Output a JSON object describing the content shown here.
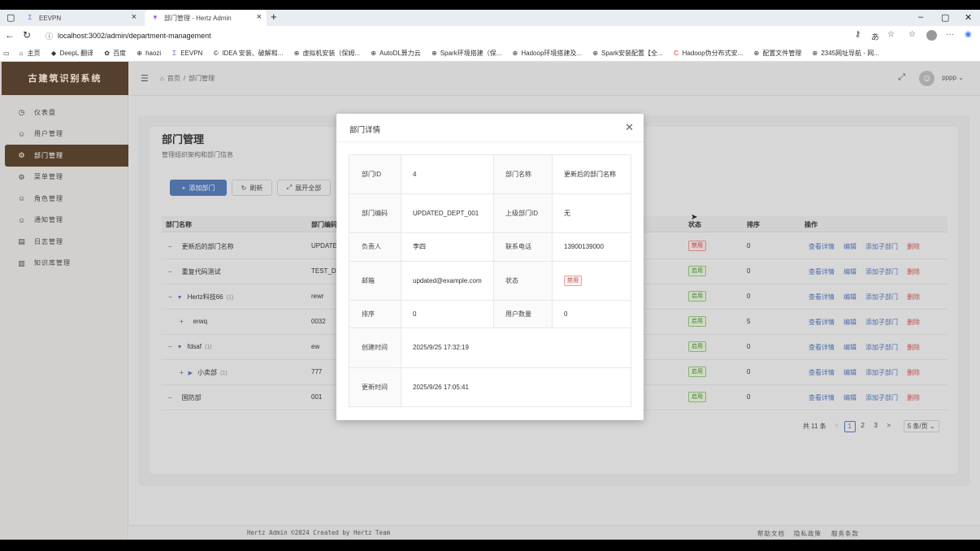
{
  "browser": {
    "tabs": [
      {
        "title": "EEVPN",
        "icon": "vpn-icon"
      },
      {
        "title": "部门管理 - Hertz Admin",
        "icon": "vite-icon"
      }
    ],
    "new_tab": "+",
    "url": "localhost:3002/admin/department-management",
    "bookmarks": [
      "主页",
      "DeepL 翻译",
      "百度",
      "haozi",
      "EEVPN",
      "IDEA 安装、破解和...",
      "虚拟机安装（保姆...",
      "AutoDL算力云",
      "Spark环境搭建（保...",
      "Hadoop环境搭建及...",
      "Spark安装配置【全...",
      "Hadoop伪分布式安...",
      "配置文件管理",
      "2345网址导航 - 网..."
    ]
  },
  "app": {
    "brand": "古建筑识别系统",
    "menu": [
      {
        "label": "仪表盘",
        "icon": "dashboard-icon"
      },
      {
        "label": "用户管理",
        "icon": "user-icon"
      },
      {
        "label": "部门管理",
        "icon": "gear-icon",
        "active": true
      },
      {
        "label": "菜单管理",
        "icon": "gear-icon"
      },
      {
        "label": "角色管理",
        "icon": "user-icon"
      },
      {
        "label": "通知管理",
        "icon": "user-icon"
      },
      {
        "label": "日志管理",
        "icon": "log-icon"
      },
      {
        "label": "知识库管理",
        "icon": "book-icon"
      }
    ],
    "breadcrumb": {
      "home": "首页",
      "sep": "/",
      "current": "部门管理"
    },
    "user": "pppp"
  },
  "page": {
    "title": "部门管理",
    "subtitle": "管理组织架构和部门信息",
    "buttons": {
      "add": "添加部门",
      "refresh": "刷新",
      "expand": "展开全部"
    },
    "columns": {
      "name": "部门名称",
      "code": "部门编码",
      "status": "状态",
      "sort": "排序",
      "ops": "操作"
    },
    "rows": [
      {
        "prefix": "−",
        "caret": "",
        "name": "更新后的部门名称",
        "count": "",
        "code": "UPDATE",
        "status": "禁用",
        "sort": "0"
      },
      {
        "prefix": "−",
        "caret": "",
        "name": "重复代码测试",
        "count": "",
        "code": "TEST_DE",
        "status": "启用",
        "sort": "0"
      },
      {
        "prefix": "−",
        "caret": "▼",
        "name": "Hertz科技66",
        "count": "(1)",
        "code": "rewr",
        "status": "启用",
        "sort": "0"
      },
      {
        "prefix": "+",
        "caret": "",
        "name": "erwq",
        "count": "",
        "code": "0032",
        "status": "启用",
        "sort": "5"
      },
      {
        "prefix": "−",
        "caret": "▼",
        "name": "fdsaf",
        "count": "(1)",
        "code": "ew",
        "status": "启用",
        "sort": "0"
      },
      {
        "prefix": "+",
        "caret": "▶",
        "name": "小卖部",
        "count": "(1)",
        "code": "777",
        "status": "启用",
        "sort": "0"
      },
      {
        "prefix": "−",
        "caret": "",
        "name": "国防部",
        "count": "",
        "code": "001",
        "status": "启用",
        "sort": "0"
      }
    ],
    "ops": {
      "view": "查看详情",
      "edit": "编辑",
      "add_child": "添加子部门",
      "delete": "删除"
    },
    "pagination": {
      "total": "共 11 条",
      "prev": "<",
      "pages": [
        "1",
        "2",
        "3"
      ],
      "next": ">",
      "size": "5 条/页"
    }
  },
  "footer": {
    "copyright": "Hertz Admin ©2024 Created by Hertz Team",
    "links": [
      "帮助文档",
      "隐私政策",
      "服务条款"
    ]
  },
  "modal": {
    "title": "部门详情",
    "fields": {
      "id_label": "部门ID",
      "id": "4",
      "name_label": "部门名称",
      "name": "更新后的部门名称",
      "code_label": "部门编码",
      "code": "UPDATED_DEPT_001",
      "parent_label": "上级部门ID",
      "parent": "无",
      "leader_label": "负责人",
      "leader": "李四",
      "phone_label": "联系电话",
      "phone": "13900139000",
      "email_label": "邮箱",
      "email": "updated@example.com",
      "status_label": "状态",
      "status": "禁用",
      "sort_label": "排序",
      "sort": "0",
      "users_label": "用户数量",
      "users": "0",
      "created_label": "创建时间",
      "created": "2025/9/25 17:32:19",
      "updated_label": "更新时间",
      "updated": "2025/9/26 17:05:41"
    }
  }
}
